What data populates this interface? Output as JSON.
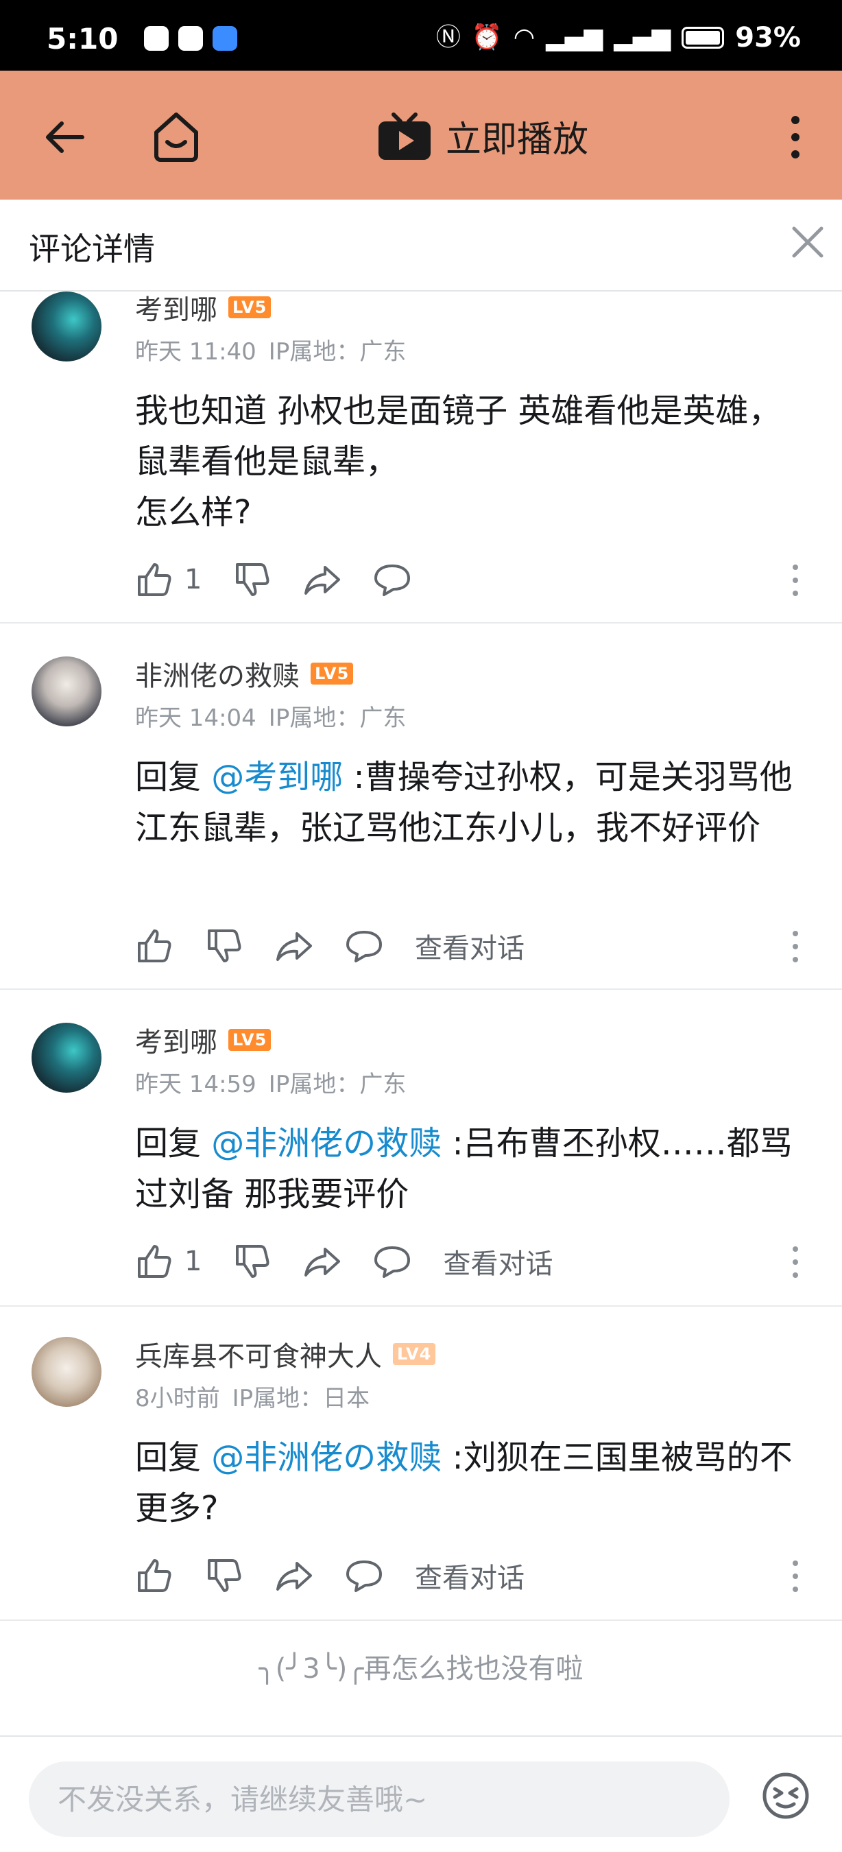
{
  "status_bar": {
    "time": "5:10",
    "battery": "93%"
  },
  "top_bar": {
    "play_label": "立即播放",
    "accent": "#e99a7a"
  },
  "panel": {
    "title": "评论详情"
  },
  "comments": [
    {
      "username": "考到哪",
      "level": "LV5",
      "time": "昨天 11:40",
      "ip": "IP属地：广东",
      "reply_prefix": "",
      "mention": "",
      "text": "我也知道 孙权也是面镜子 英雄看他是英雄，鼠辈看他是鼠辈，\n怎么样?",
      "likes": "1",
      "view_convo": ""
    },
    {
      "username": "非洲佬の救赎",
      "level": "LV5",
      "time": "昨天 14:04",
      "ip": "IP属地：广东",
      "reply_prefix": "回复 ",
      "mention": "@考到哪",
      "text": " :曹操夸过孙权，可是关羽骂他江东鼠辈，张辽骂他江东小儿，我不好评价",
      "likes": "",
      "view_convo": "查看对话"
    },
    {
      "username": "考到哪",
      "level": "LV5",
      "time": "昨天 14:59",
      "ip": "IP属地：广东",
      "reply_prefix": "回复 ",
      "mention": "@非洲佬の救赎",
      "text": " :吕布曹丕孙权……都骂过刘备 那我要评价",
      "likes": "1",
      "view_convo": "查看对话"
    },
    {
      "username": "兵库县不可食神大人",
      "level": "LV4",
      "time": "8小时前",
      "ip": "IP属地：日本",
      "reply_prefix": "回复 ",
      "mention": "@非洲佬の救赎",
      "text": " :刘狈在三国里被骂的不更多?",
      "likes": "",
      "view_convo": "查看对话"
    }
  ],
  "end_hint": "╮(╯3╰)╭再怎么找也没有啦",
  "bottom_bar": {
    "placeholder": "不发没关系，请继续友善哦~"
  }
}
